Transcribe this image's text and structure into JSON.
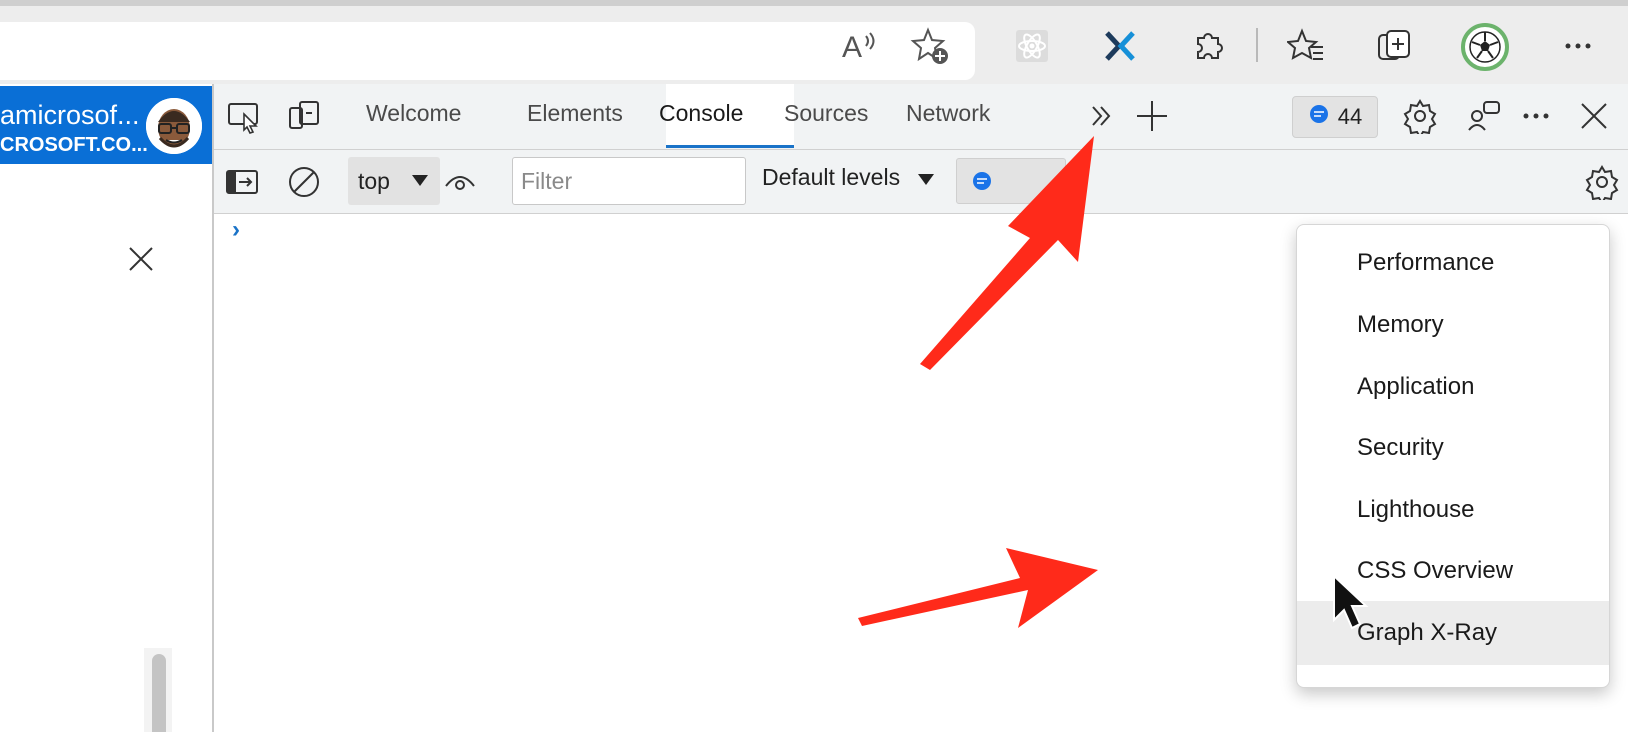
{
  "account": {
    "name": "amicrosof...",
    "email": "CROSOFT.CO..."
  },
  "devtools": {
    "tabs": [
      {
        "label": "Welcome"
      },
      {
        "label": "Elements"
      },
      {
        "label": "Console"
      },
      {
        "label": "Sources"
      },
      {
        "label": "Network"
      }
    ],
    "active_tab": "Console",
    "issues_count": "44",
    "toolbar": {
      "context": "top",
      "filter_placeholder": "Filter",
      "levels": "Default levels"
    },
    "prompt_symbol": "›"
  },
  "more_tools_menu": {
    "items": [
      {
        "label": "Performance"
      },
      {
        "label": "Memory"
      },
      {
        "label": "Application"
      },
      {
        "label": "Security"
      },
      {
        "label": "Lighthouse"
      },
      {
        "label": "CSS Overview"
      },
      {
        "label": "Graph X-Ray"
      }
    ],
    "hovered_item": "Graph X-Ray"
  },
  "colors": {
    "accent": "#1a73c8",
    "account_bg": "#0a6fd6",
    "arrow": "#ff2a1a",
    "hover": "#ececec"
  },
  "icons": {
    "browser_toolbar": [
      "read-aloud-icon",
      "add-favorite-icon",
      "react-devtools-icon",
      "graph-xray-extension-icon",
      "extensions-icon",
      "favorites-icon",
      "collections-icon",
      "profile-icon",
      "more-icon"
    ],
    "devtools_tabbar": [
      "inspect-icon",
      "device-emulation-icon",
      "more-tabs-icon",
      "new-tab-icon",
      "issues-icon",
      "settings-icon",
      "feedback-icon",
      "more-options-icon",
      "close-icon"
    ],
    "console_toolbar": [
      "sidebar-icon",
      "clear-icon",
      "live-expression-eye-icon",
      "console-settings-icon"
    ]
  }
}
